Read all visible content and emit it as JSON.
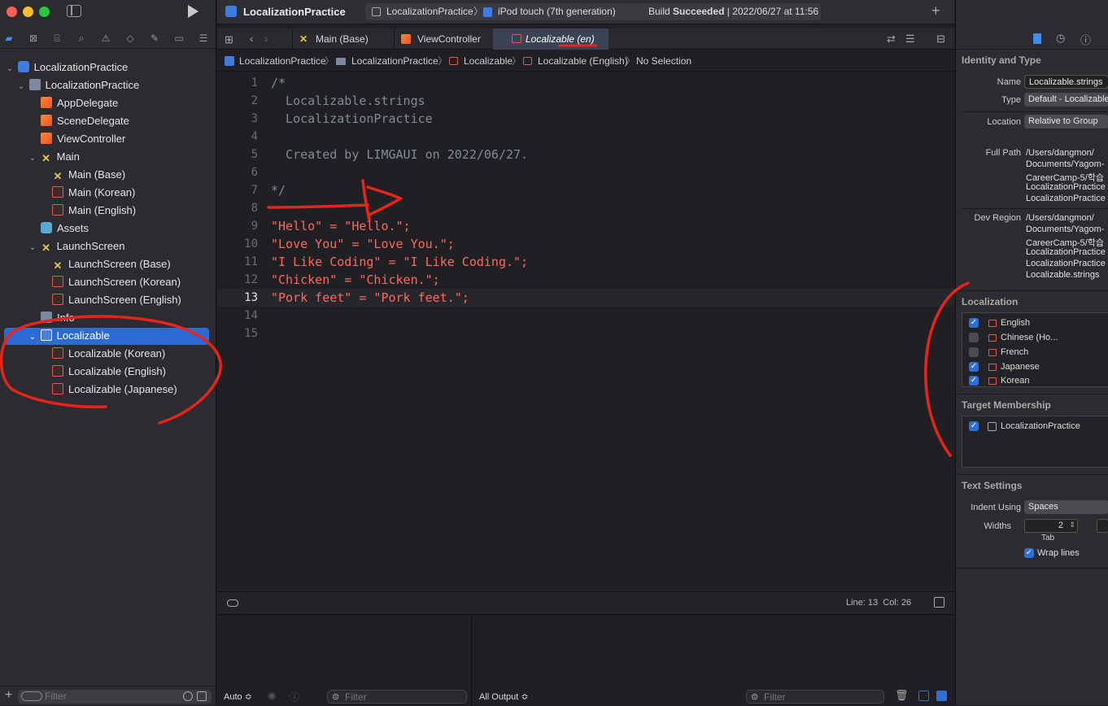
{
  "navigator": {
    "tree": [
      {
        "label": "LocalizationPractice",
        "icon": "project-icon"
      },
      {
        "label": "LocalizationPractice",
        "icon": "folder-icon"
      },
      {
        "label": "AppDelegate",
        "icon": "swift-file-icon"
      },
      {
        "label": "SceneDelegate",
        "icon": "swift-file-icon"
      },
      {
        "label": "ViewController",
        "icon": "swift-file-icon"
      },
      {
        "label": "Main",
        "icon": "storyboard-icon"
      },
      {
        "label": "Main (Base)",
        "icon": "storyboard-icon"
      },
      {
        "label": "Main (Korean)",
        "icon": "strings-file-icon"
      },
      {
        "label": "Main (English)",
        "icon": "strings-file-icon"
      },
      {
        "label": "Assets",
        "icon": "assets-icon"
      },
      {
        "label": "LaunchScreen",
        "icon": "storyboard-icon"
      },
      {
        "label": "LaunchScreen (Base)",
        "icon": "storyboard-icon"
      },
      {
        "label": "LaunchScreen (Korean)",
        "icon": "strings-file-icon"
      },
      {
        "label": "LaunchScreen (English)",
        "icon": "strings-file-icon"
      },
      {
        "label": "Info",
        "icon": "plist-icon"
      },
      {
        "label": "Localizable",
        "icon": "strings-file-icon"
      },
      {
        "label": "Localizable (Korean)",
        "icon": "strings-file-icon"
      },
      {
        "label": "Localizable (English)",
        "icon": "strings-file-icon"
      },
      {
        "label": "Localizable (Japanese)",
        "icon": "strings-file-icon"
      }
    ],
    "filter_placeholder": "Filter"
  },
  "toolbar": {
    "project_title": "LocalizationPractice",
    "scheme": "LocalizationPractice",
    "destination": "iPod touch (7th generation)",
    "build_status_prefix": "Build ",
    "build_status_bold": "Succeeded",
    "build_status_suffix": " | 2022/06/27 at 11:56"
  },
  "tabs": [
    {
      "label": "Main (Base)"
    },
    {
      "label": "ViewController"
    },
    {
      "label": "Localizable (en)"
    }
  ],
  "breadcrumb": {
    "items": [
      "LocalizationPractice",
      "LocalizationPractice",
      "Localizable",
      "Localizable (English)",
      "No Selection"
    ]
  },
  "editor": {
    "lines": [
      {
        "n": "1",
        "text": "/*",
        "kind": "cmt"
      },
      {
        "n": "2",
        "text": "  Localizable.strings",
        "kind": "cmt"
      },
      {
        "n": "3",
        "text": "  LocalizationPractice",
        "kind": "cmt"
      },
      {
        "n": "4",
        "text": "",
        "kind": "cmt"
      },
      {
        "n": "5",
        "text": "  Created by LIMGAUI on 2022/06/27.",
        "kind": "cmt"
      },
      {
        "n": "6",
        "text": "",
        "kind": "cmt"
      },
      {
        "n": "7",
        "text": "*/",
        "kind": "cmt"
      },
      {
        "n": "8",
        "text": "",
        "kind": "cmt"
      },
      {
        "n": "9",
        "text": "\"Hello\" = \"Hello.\";",
        "kind": "str"
      },
      {
        "n": "10",
        "text": "\"Love You\" = \"Love You.\";",
        "kind": "str"
      },
      {
        "n": "11",
        "text": "\"I Like Coding\" = \"I Like Coding.\";",
        "kind": "str"
      },
      {
        "n": "12",
        "text": "\"Chicken\" = \"Chicken.\";",
        "kind": "str"
      },
      {
        "n": "13",
        "text": "\"Pork feet\" = \"Pork feet.\";",
        "kind": "str"
      },
      {
        "n": "14",
        "text": "",
        "kind": "cmt"
      },
      {
        "n": "15",
        "text": "",
        "kind": "cmt"
      }
    ],
    "current_line": "13",
    "status": "Line: 13  Col: 26"
  },
  "debug": {
    "auto_label": "Auto ≎",
    "filter_placeholder": "Filter",
    "output_label": "All Output ≎",
    "filter2_placeholder": "Filter"
  },
  "inspector": {
    "identity_title": "Identity and Type",
    "name_label": "Name",
    "name_value": "Localizable.strings",
    "type_label": "Type",
    "type_value": "Default - Localizable",
    "location_label": "Location",
    "location_value": "Relative to Group",
    "fullpath_label": "Full Path",
    "fullpath_lines": [
      "/Users/dangmon/",
      "Documents/Yagom-",
      "CareerCamp-5/학습",
      "LocalizationPractice",
      "LocalizationPractice"
    ],
    "devregion_label": "Dev Region",
    "devregion_lines": [
      "/Users/dangmon/",
      "Documents/Yagom-",
      "CareerCamp-5/학습",
      "LocalizationPractice",
      "LocalizationPractice",
      "Localizable.strings"
    ],
    "localization_title": "Localization",
    "localizations": [
      {
        "label": "English",
        "checked": true
      },
      {
        "label": "Chinese (Ho...",
        "checked": false
      },
      {
        "label": "French",
        "checked": false
      },
      {
        "label": "Japanese",
        "checked": true
      },
      {
        "label": "Korean",
        "checked": true
      }
    ],
    "target_title": "Target Membership",
    "target_item": "LocalizationPractice",
    "text_settings_title": "Text Settings",
    "indent_label": "Indent Using",
    "indent_value": "Spaces",
    "widths_label": "Widths",
    "tab_value": "2",
    "tab_label": "Tab",
    "wrap_label": "Wrap lines"
  }
}
